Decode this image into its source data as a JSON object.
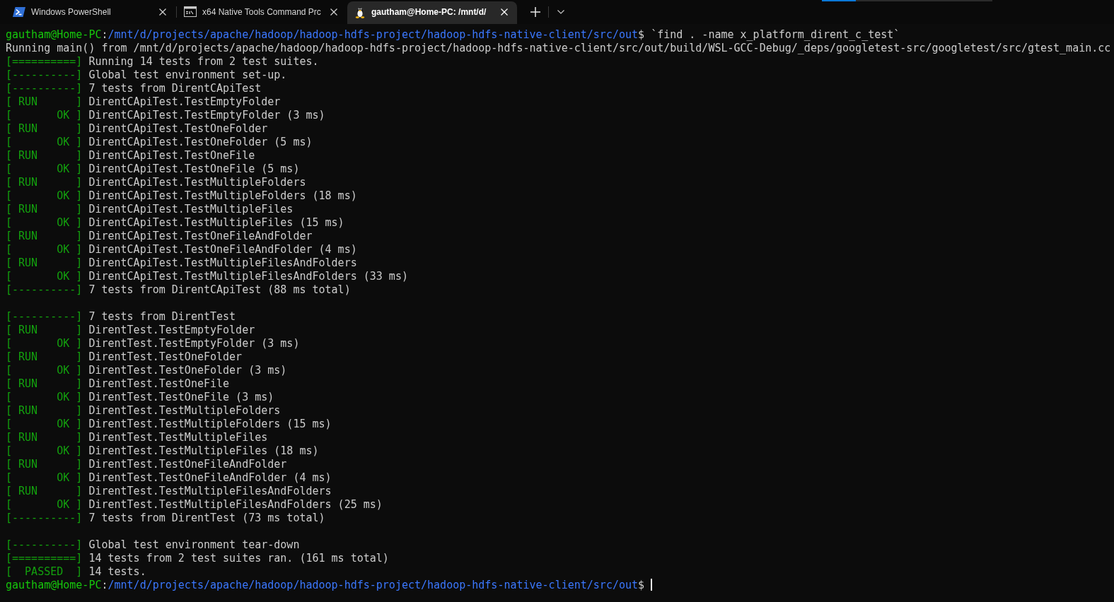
{
  "tabs": [
    {
      "kind": "powershell",
      "title": "Windows PowerShell",
      "selected": false
    },
    {
      "kind": "cmd",
      "title": "x64 Native Tools Command Prc",
      "selected": false
    },
    {
      "kind": "linux",
      "title": "gautham@Home-PC: /mnt/d/",
      "selected": true
    }
  ],
  "progress": {
    "level": 0.2
  },
  "terminal": {
    "lines": [
      {
        "kind": "prompt",
        "user": "gautham@Home-PC",
        "separator": ":",
        "path": "/mnt/d/projects/apache/hadoop/hadoop-hdfs-project/hadoop-hdfs-native-client/src/out",
        "symbol": "$",
        "command": "`find . -name x_platform_dirent_c_test`"
      },
      {
        "kind": "plain",
        "text": "Running main() from /mnt/d/projects/apache/hadoop/hadoop-hdfs-project/hadoop-hdfs-native-client/src/out/build/WSL-GCC-Debug/_deps/googletest-src/googletest/src/gtest_main.cc"
      },
      {
        "kind": "gtest",
        "tag": "[==========]",
        "text": "Running 14 tests from 2 test suites."
      },
      {
        "kind": "gtest",
        "tag": "[----------]",
        "text": "Global test environment set-up."
      },
      {
        "kind": "gtest",
        "tag": "[----------]",
        "text": "7 tests from DirentCApiTest"
      },
      {
        "kind": "gtest",
        "tag": "[ RUN      ]",
        "text": "DirentCApiTest.TestEmptyFolder"
      },
      {
        "kind": "gtest",
        "tag": "[       OK ]",
        "text": "DirentCApiTest.TestEmptyFolder (3 ms)"
      },
      {
        "kind": "gtest",
        "tag": "[ RUN      ]",
        "text": "DirentCApiTest.TestOneFolder"
      },
      {
        "kind": "gtest",
        "tag": "[       OK ]",
        "text": "DirentCApiTest.TestOneFolder (5 ms)"
      },
      {
        "kind": "gtest",
        "tag": "[ RUN      ]",
        "text": "DirentCApiTest.TestOneFile"
      },
      {
        "kind": "gtest",
        "tag": "[       OK ]",
        "text": "DirentCApiTest.TestOneFile (5 ms)"
      },
      {
        "kind": "gtest",
        "tag": "[ RUN      ]",
        "text": "DirentCApiTest.TestMultipleFolders"
      },
      {
        "kind": "gtest",
        "tag": "[       OK ]",
        "text": "DirentCApiTest.TestMultipleFolders (18 ms)"
      },
      {
        "kind": "gtest",
        "tag": "[ RUN      ]",
        "text": "DirentCApiTest.TestMultipleFiles"
      },
      {
        "kind": "gtest",
        "tag": "[       OK ]",
        "text": "DirentCApiTest.TestMultipleFiles (15 ms)"
      },
      {
        "kind": "gtest",
        "tag": "[ RUN      ]",
        "text": "DirentCApiTest.TestOneFileAndFolder"
      },
      {
        "kind": "gtest",
        "tag": "[       OK ]",
        "text": "DirentCApiTest.TestOneFileAndFolder (4 ms)"
      },
      {
        "kind": "gtest",
        "tag": "[ RUN      ]",
        "text": "DirentCApiTest.TestMultipleFilesAndFolders"
      },
      {
        "kind": "gtest",
        "tag": "[       OK ]",
        "text": "DirentCApiTest.TestMultipleFilesAndFolders (33 ms)"
      },
      {
        "kind": "gtest",
        "tag": "[----------]",
        "text": "7 tests from DirentCApiTest (88 ms total)"
      },
      {
        "kind": "blank"
      },
      {
        "kind": "gtest",
        "tag": "[----------]",
        "text": "7 tests from DirentTest"
      },
      {
        "kind": "gtest",
        "tag": "[ RUN      ]",
        "text": "DirentTest.TestEmptyFolder"
      },
      {
        "kind": "gtest",
        "tag": "[       OK ]",
        "text": "DirentTest.TestEmptyFolder (3 ms)"
      },
      {
        "kind": "gtest",
        "tag": "[ RUN      ]",
        "text": "DirentTest.TestOneFolder"
      },
      {
        "kind": "gtest",
        "tag": "[       OK ]",
        "text": "DirentTest.TestOneFolder (3 ms)"
      },
      {
        "kind": "gtest",
        "tag": "[ RUN      ]",
        "text": "DirentTest.TestOneFile"
      },
      {
        "kind": "gtest",
        "tag": "[       OK ]",
        "text": "DirentTest.TestOneFile (3 ms)"
      },
      {
        "kind": "gtest",
        "tag": "[ RUN      ]",
        "text": "DirentTest.TestMultipleFolders"
      },
      {
        "kind": "gtest",
        "tag": "[       OK ]",
        "text": "DirentTest.TestMultipleFolders (15 ms)"
      },
      {
        "kind": "gtest",
        "tag": "[ RUN      ]",
        "text": "DirentTest.TestMultipleFiles"
      },
      {
        "kind": "gtest",
        "tag": "[       OK ]",
        "text": "DirentTest.TestMultipleFiles (18 ms)"
      },
      {
        "kind": "gtest",
        "tag": "[ RUN      ]",
        "text": "DirentTest.TestOneFileAndFolder"
      },
      {
        "kind": "gtest",
        "tag": "[       OK ]",
        "text": "DirentTest.TestOneFileAndFolder (4 ms)"
      },
      {
        "kind": "gtest",
        "tag": "[ RUN      ]",
        "text": "DirentTest.TestMultipleFilesAndFolders"
      },
      {
        "kind": "gtest",
        "tag": "[       OK ]",
        "text": "DirentTest.TestMultipleFilesAndFolders (25 ms)"
      },
      {
        "kind": "gtest",
        "tag": "[----------]",
        "text": "7 tests from DirentTest (73 ms total)"
      },
      {
        "kind": "blank"
      },
      {
        "kind": "gtest",
        "tag": "[----------]",
        "text": "Global test environment tear-down"
      },
      {
        "kind": "gtest",
        "tag": "[==========]",
        "text": "14 tests from 2 test suites ran. (161 ms total)"
      },
      {
        "kind": "gtest",
        "tag": "[  PASSED  ]",
        "text": "14 tests."
      },
      {
        "kind": "prompt",
        "user": "gautham@Home-PC",
        "separator": ":",
        "path": "/mnt/d/projects/apache/hadoop/hadoop-hdfs-project/hadoop-hdfs-native-client/src/out",
        "symbol": "$",
        "cursor": true
      }
    ]
  }
}
